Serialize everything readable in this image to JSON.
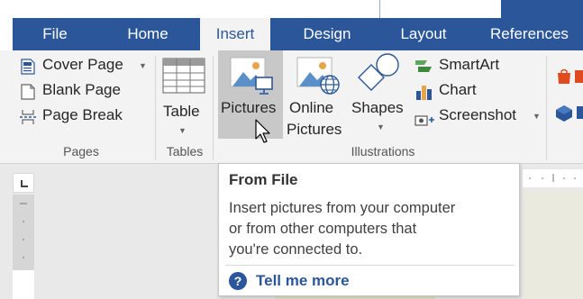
{
  "tabs": {
    "file": "File",
    "home": "Home",
    "insert": "Insert",
    "design": "Design",
    "layout": "Layout",
    "references": "References",
    "active": "Insert"
  },
  "ribbon": {
    "pages": {
      "cover_page": "Cover Page",
      "blank_page": "Blank Page",
      "page_break": "Page Break",
      "label": "Pages"
    },
    "tables": {
      "table": "Table",
      "label": "Tables"
    },
    "illustrations": {
      "pictures": "Pictures",
      "online_pictures_line1": "Online",
      "online_pictures_line2": "Pictures",
      "shapes": "Shapes",
      "smartart": "SmartArt",
      "chart": "Chart",
      "screenshot": "Screenshot",
      "label": "Illustrations"
    }
  },
  "tooltip": {
    "title": "From File",
    "desc_line1": "Insert pictures from your computer",
    "desc_line2": "or from other computers that",
    "desc_line3": "you're connected to.",
    "tell_me_more": "Tell me more"
  },
  "colors": {
    "accent": "#2b579a",
    "ribbon_bg": "#f3f3f3",
    "hover": "#c8c8c8"
  },
  "icons": {
    "cover_page": "cover-page-icon",
    "blank_page": "blank-page-icon",
    "page_break": "page-break-icon",
    "table": "table-icon",
    "pictures": "pictures-icon",
    "online_pictures": "online-pictures-icon",
    "shapes": "shapes-icon",
    "smartart": "smartart-icon",
    "chart": "chart-icon",
    "screenshot": "screenshot-icon",
    "help": "help-icon"
  }
}
